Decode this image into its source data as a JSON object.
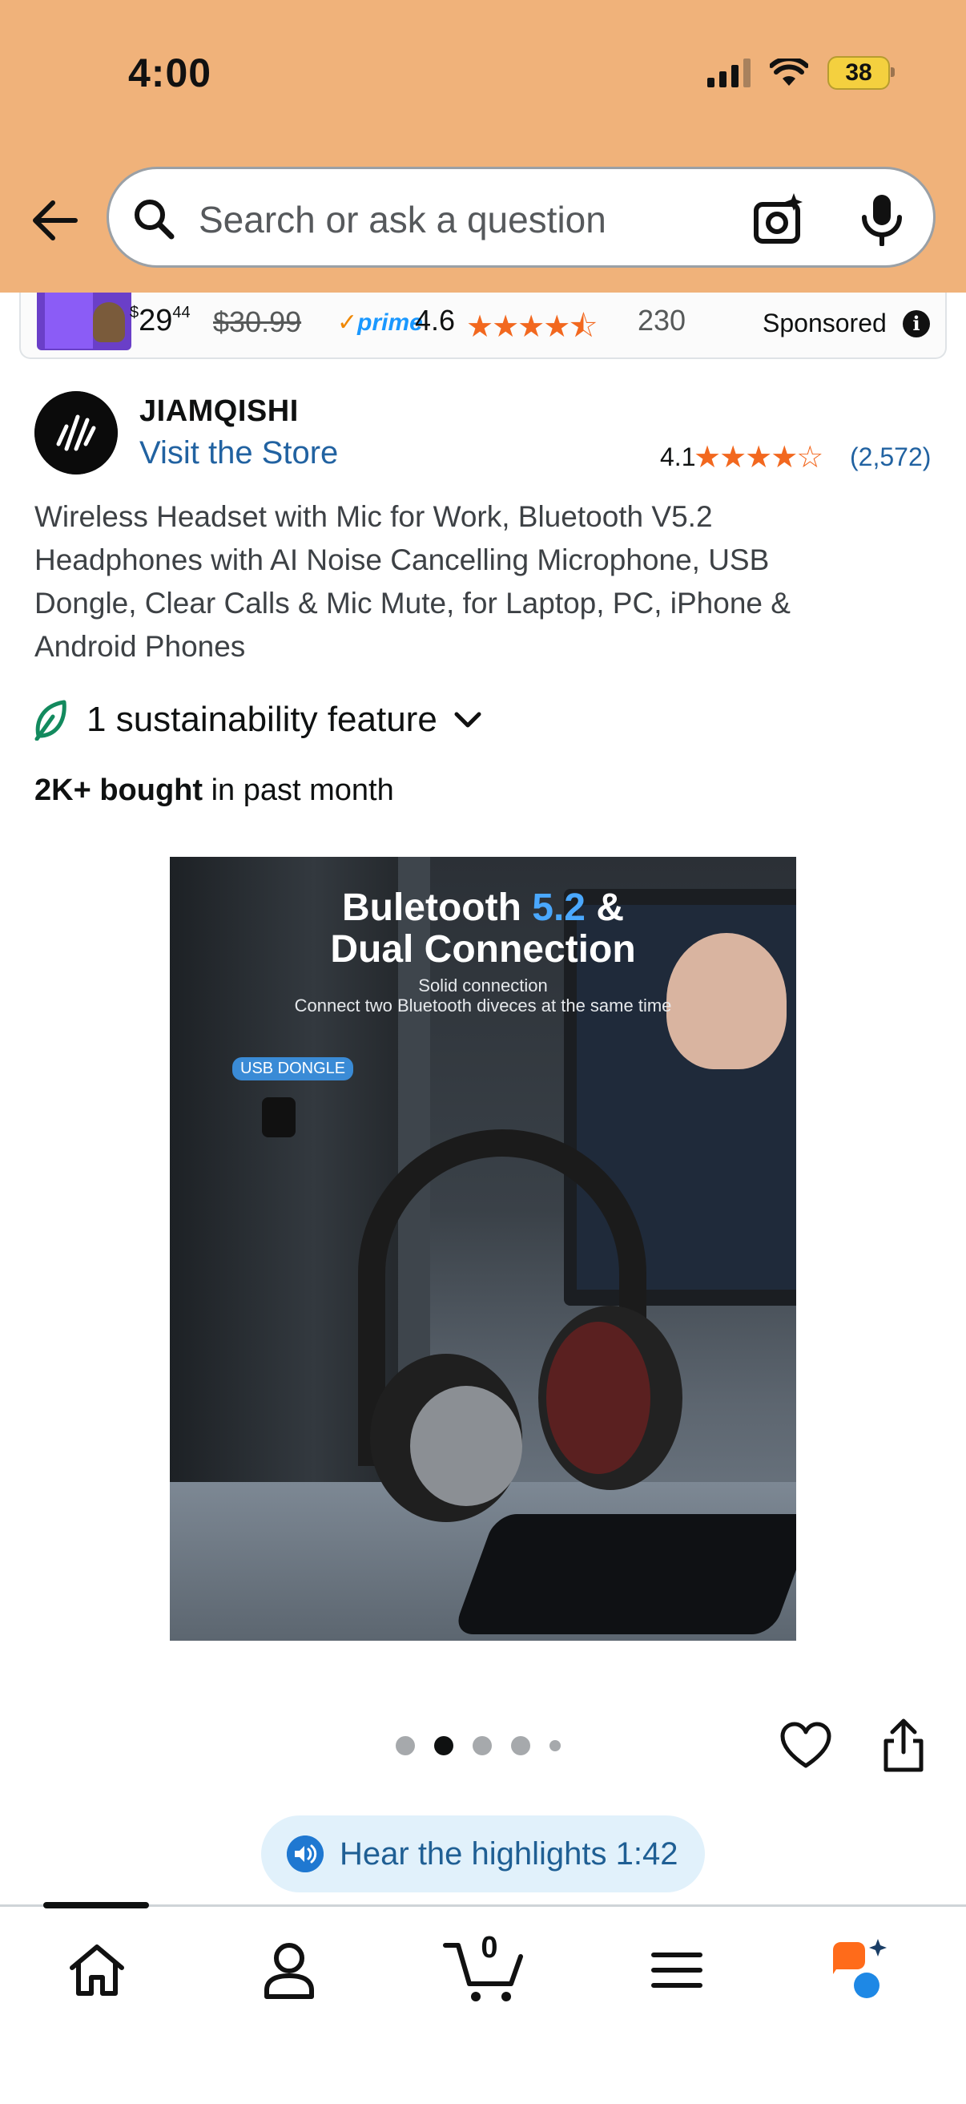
{
  "status_bar": {
    "time": "4:00",
    "battery": "38"
  },
  "search": {
    "placeholder": "Search or ask a question"
  },
  "sponsored_ad": {
    "price_currency": "$",
    "price_dollars": "29",
    "price_cents": "44",
    "old_price": "$30.99",
    "prime": "prime",
    "rating": "4.6",
    "stars": "★★★★⯪",
    "review_count": "230",
    "label": "Sponsored"
  },
  "brand": {
    "name": "JIAMQISHI",
    "store_link": "Visit the Store",
    "rating": "4.1",
    "stars": "★★★★☆",
    "review_count": "(2,572)"
  },
  "product": {
    "title": "Wireless Headset with Mic for Work, Bluetooth V5.2 Headphones with AI Noise Cancelling Microphone, USB Dongle, Clear Calls & Mic Mute, for Laptop, PC, iPhone & Android Phones",
    "sustainability": "1 sustainability feature",
    "bought_bold": "2K+ bought",
    "bought_rest": " in past month"
  },
  "product_image": {
    "headline_a": "Buletooth ",
    "headline_accent": "5.2",
    "headline_b": " &",
    "headline_line2": "Dual Connection",
    "sub1": "Solid connection",
    "sub2": "Connect two Bluetooth diveces at the same time",
    "usb_label": "USB DONGLE"
  },
  "carousel": {
    "total": 5,
    "active_index": 1
  },
  "highlights": {
    "label": "Hear the highlights 1:42"
  },
  "nav": {
    "cart_count": "0"
  },
  "colors": {
    "header_bg": "#f0b27a",
    "star": "#f2681f",
    "link": "#2162a1"
  }
}
